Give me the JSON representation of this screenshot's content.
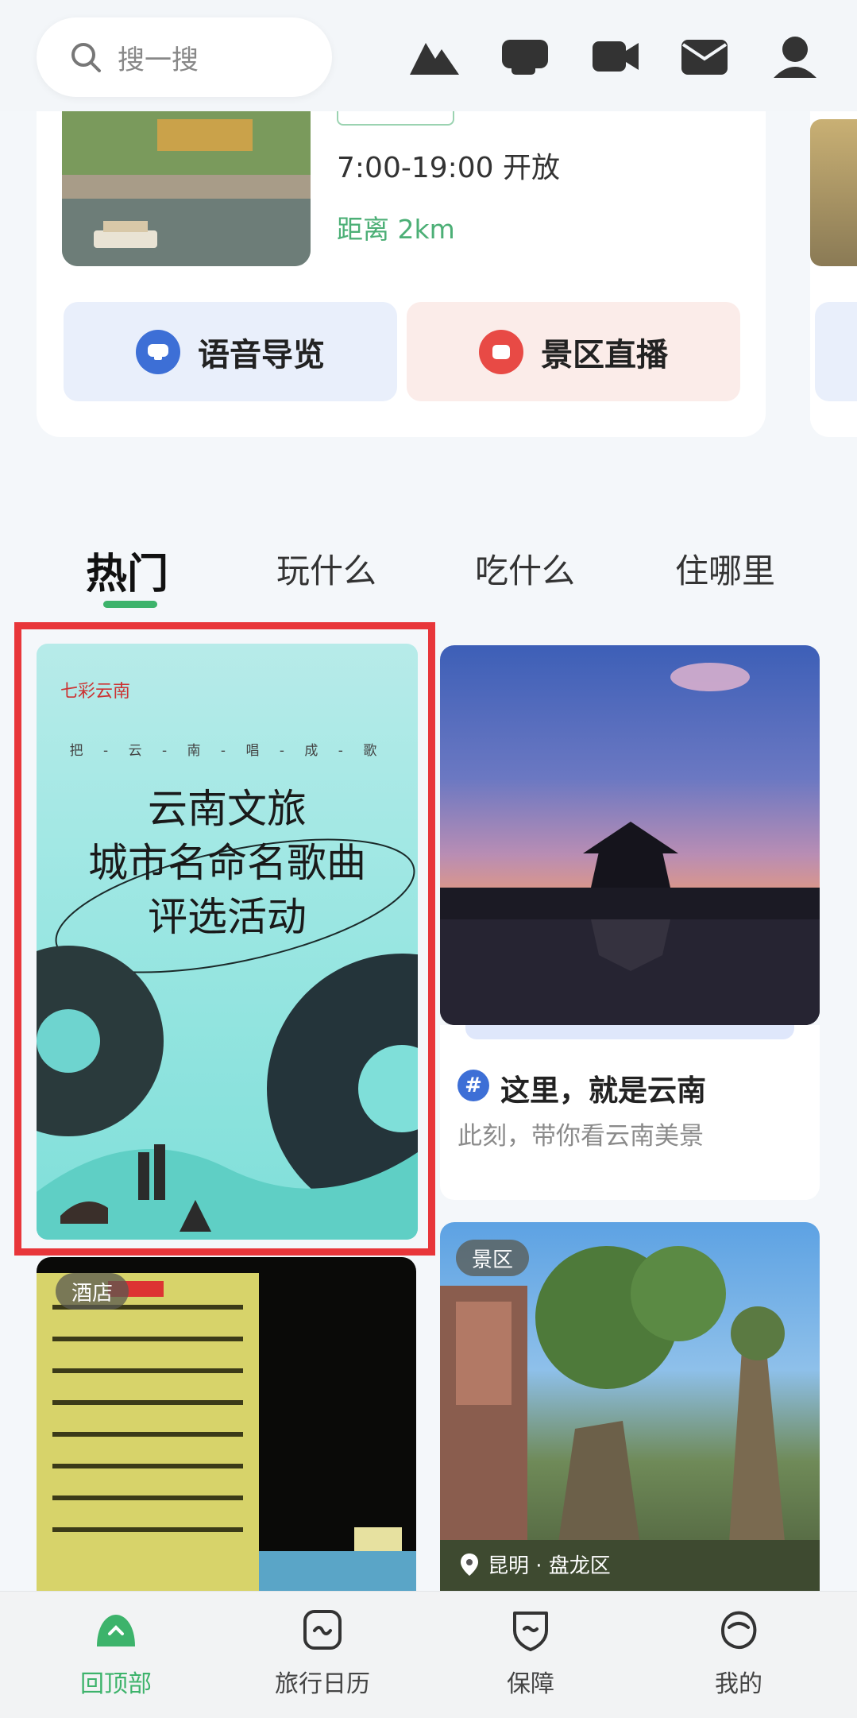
{
  "search": {
    "placeholder": "搜一搜"
  },
  "top_icons": [
    "mountain-icon",
    "ticket-icon",
    "video-icon",
    "mail-icon",
    "profile-icon"
  ],
  "attraction": {
    "hours": "7:00-19:00 开放",
    "distance": "距离 2km",
    "voice_guide_label": "语音导览",
    "live_label": "景区直播"
  },
  "tabs": [
    {
      "label": "热门",
      "active": true
    },
    {
      "label": "玩什么",
      "active": false
    },
    {
      "label": "吃什么",
      "active": false
    },
    {
      "label": "住哪里",
      "active": false
    }
  ],
  "feed": {
    "poster": {
      "logo": "七彩云南",
      "kicker": "把 - 云 - 南 - 唱 - 成 - 歌",
      "title_lines": [
        "云南文旅",
        "城市名命名歌曲",
        "评选活动"
      ]
    },
    "topic_card": {
      "title": "这里，就是云南",
      "subtitle": "此刻，带你看云南美景"
    },
    "hotel_card": {
      "tag": "酒店"
    },
    "scenic_card": {
      "tag": "景区",
      "location": "昆明 · 盘龙区"
    }
  },
  "bottom_nav": [
    {
      "label": "回顶部",
      "icon": "back-to-top-icon",
      "active": true
    },
    {
      "label": "旅行日历",
      "icon": "calendar-icon",
      "active": false
    },
    {
      "label": "保障",
      "icon": "shield-icon",
      "active": false
    },
    {
      "label": "我的",
      "icon": "profile-icon",
      "active": false
    }
  ],
  "colors": {
    "accent_green": "#3db36b",
    "highlight_red": "#e8363a",
    "voice_blue": "#3d6fd6",
    "live_red": "#e84a45"
  }
}
